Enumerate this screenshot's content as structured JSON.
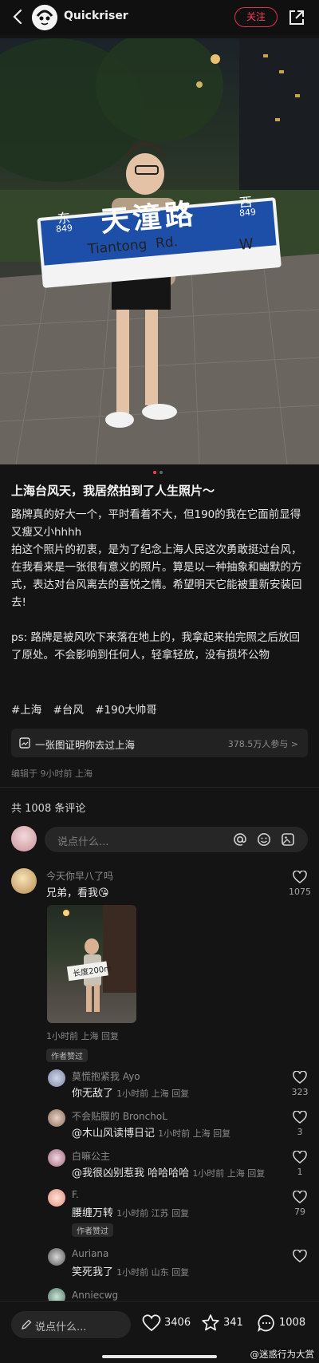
{
  "header": {
    "username": "Quickriser",
    "follow_label": "关注"
  },
  "photo": {
    "sign_left_char": "东",
    "sign_left_num": "849",
    "sign_main": "天潼路",
    "sign_right_char": "西",
    "sign_right_num": "849",
    "sign_sub": "Tiantong  Rd.",
    "sign_dir": "W"
  },
  "post": {
    "title": "上海台风天，我居然拍到了人生照片～",
    "paragraphs": [
      "路牌真的好大一个，平时看着不大，但190的我在它面前显得又瘦又小hhhh",
      "拍这个照片的初衷，是为了纪念上海人民这次勇敢挺过台风，在我看来是一张很有意义的照片。算是以一种抽象和幽默的方式，表达对台风离去的喜悦之情。希望明天它能被重新安装回去!",
      "ps: 路牌是被风吹下来落在地上的，我拿起来拍完照之后放回了原处。不会影响到任何人，轻拿轻放，没有损坏公物"
    ],
    "tags": [
      "#上海",
      "#台风",
      "#190大帅哥"
    ],
    "topic_label": "一张图证明你去过上海",
    "topic_count": "378.5万人参与 >",
    "edited": "编辑于 9小时前 上海"
  },
  "comments_header": "共 1008 条评论",
  "comment_input_placeholder": "说点什么...",
  "comments": [
    {
      "name": "今天你早八了吗",
      "text": "兄弟，看我😘",
      "meta": "1小时前 上海 回复",
      "likes": "1075",
      "image_text": "长度200m",
      "badge": "作者赞过",
      "replies": [
        {
          "name": "莫慌抱紧我 Ayo",
          "text": "你无敌了",
          "meta": "1小时前 上海 回复",
          "likes": "323"
        },
        {
          "name": "不会贴膜的 BronchoL",
          "mention": "@木山风读博日记",
          "meta": "1小时前 上海 回复",
          "likes": "3"
        },
        {
          "name": "白嘛公主",
          "mention": "@我很凶别惹我",
          "text": "哈哈哈哈",
          "meta": "1小时前 上海 回复",
          "likes": "1"
        },
        {
          "name": "F.",
          "text": "腰缠万转",
          "meta": "1小时前 江苏 回复",
          "likes": "79",
          "badge": "作者赞过"
        },
        {
          "name": "Auriana",
          "text": "笑死我了",
          "meta": "1小时前 山东 回复"
        },
        {
          "name": "Anniecwg"
        }
      ]
    }
  ],
  "bottom_bar": {
    "placeholder": "说点什么...",
    "likes": "3406",
    "stars": "341",
    "comments": "1008",
    "watermark": "@迷惑行为大赏"
  },
  "colors": {
    "follow": "#ff3b55",
    "sign": "#1d4fa8"
  }
}
